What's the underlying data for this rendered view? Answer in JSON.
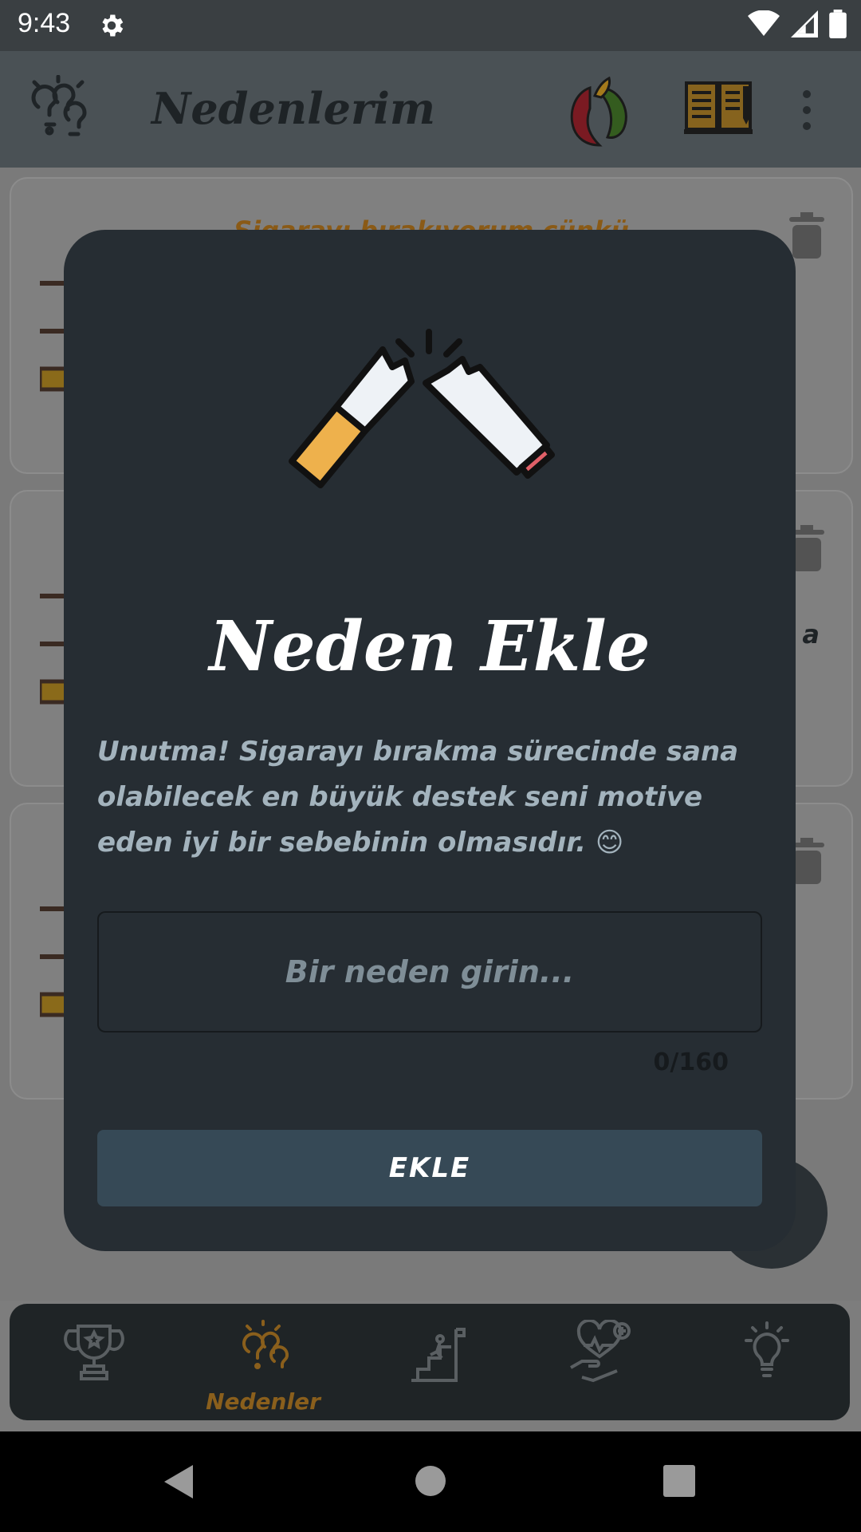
{
  "status_bar": {
    "time": "9:43"
  },
  "app_bar": {
    "title": "Nedenlerim",
    "icons": [
      "brain-ideas-icon",
      "peppers-icon",
      "book-icon",
      "more-vert-icon"
    ]
  },
  "background_list": {
    "card_heading": "Sigarayı bırakıyorum çünkü",
    "partial_text": "a"
  },
  "dialog": {
    "title": "Neden Ekle",
    "message": "Unutma! Sigarayı bırakma sürecinde sana olabilecek en büyük destek seni motive eden iyi bir sebebinin olmasıdır. 😊",
    "input": {
      "value": "",
      "placeholder": "Bir neden girin..."
    },
    "counter": "0/160",
    "add_button": "EKLE",
    "illustration": "broken-cigarette-icon"
  },
  "bottom_nav": {
    "items": [
      {
        "icon": "trophy-icon",
        "label": ""
      },
      {
        "icon": "brain-ideas-icon",
        "label": "Nedenler"
      },
      {
        "icon": "climb-progress-icon",
        "label": ""
      },
      {
        "icon": "health-hand-icon",
        "label": ""
      },
      {
        "icon": "lightbulb-icon",
        "label": ""
      }
    ],
    "active_index": 1
  },
  "colors": {
    "dialog_bg": "#262d33",
    "button_bg": "#364956",
    "accent": "#e0a23a"
  }
}
